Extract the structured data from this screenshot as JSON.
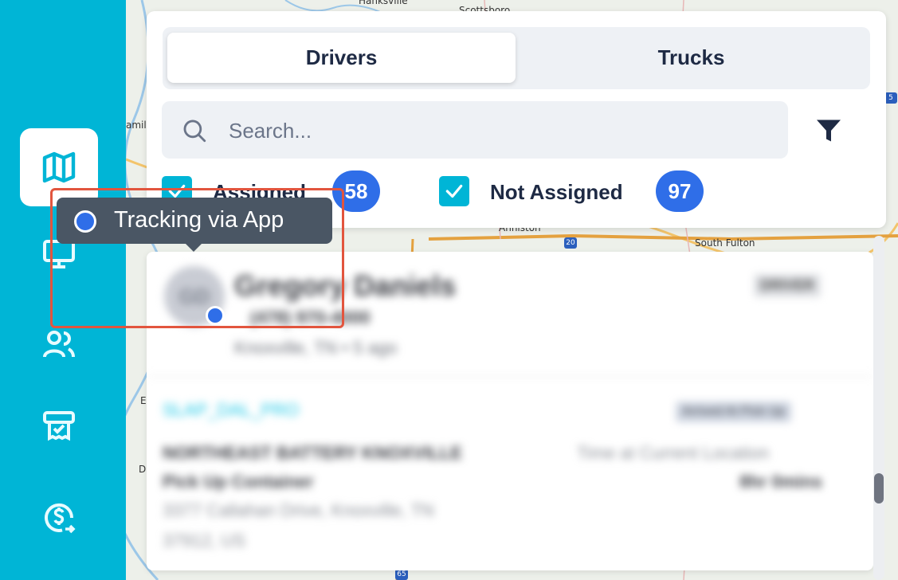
{
  "map": {
    "labels": [
      "Hanksville",
      "Scottsboro",
      "Anniston",
      "South Fulton",
      "amil",
      "E",
      "D"
    ],
    "shields": [
      "20",
      "65",
      "5"
    ]
  },
  "sidebar": {
    "items": [
      {
        "icon": "map-icon",
        "active": true
      },
      {
        "icon": "monitor-icon",
        "active": false
      },
      {
        "icon": "users-icon",
        "active": false
      },
      {
        "icon": "receipt-icon",
        "active": false
      },
      {
        "icon": "dollar-icon",
        "active": false
      }
    ]
  },
  "tabs": {
    "drivers": "Drivers",
    "trucks": "Trucks"
  },
  "search": {
    "placeholder": "Search..."
  },
  "filters": {
    "assigned_label": "Assigned",
    "assigned_count": "58",
    "not_assigned_label": "Not Assigned",
    "not_assigned_count": "97"
  },
  "tooltip": {
    "text": "Tracking via App"
  },
  "driver_card": {
    "initials": "GD",
    "name": "Gregory Daniels",
    "id": "DRIVER",
    "phone": "(478) 970-4000",
    "location": "Knoxville, TN • 5 ago",
    "load_id": "SLAP_DAL_PRO",
    "load_status": "Arrived At Pick Up",
    "company": "NORTHEAST BATTERY KNOXVILLE",
    "time_label": "Time at Current Location",
    "action": "Pick Up Container",
    "duration": "8hr 0mins",
    "address_line1": "3377 Callahan Drive, Knoxville, TN",
    "address_line2": "37912, US"
  },
  "colors": {
    "sidebar": "#00b5d6",
    "accent_blue": "#2f6ee8",
    "tooltip_bg": "#4a5664",
    "highlight": "#e2553e"
  }
}
